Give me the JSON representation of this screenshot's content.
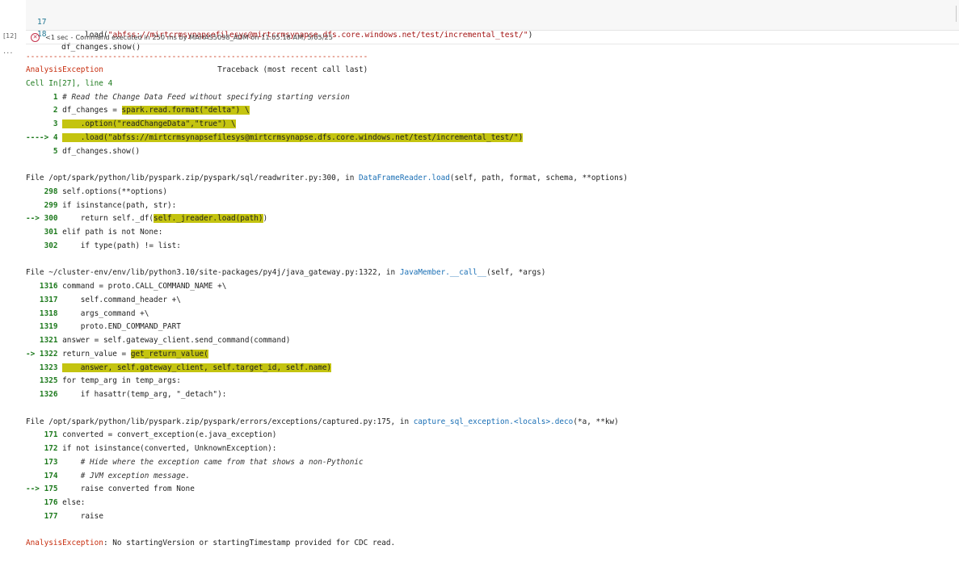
{
  "cell_editor": {
    "lines": [
      {
        "number": "17",
        "prefix": "    .load(",
        "string": "\"abfss://mirtcrmsynapsefilesys@mirtcrmsynapse.dfs.core.windows.net/test/incremental_test/\"",
        "suffix": ")"
      },
      {
        "number": "18",
        "prefix": "df_changes.show()",
        "string": "",
        "suffix": ""
      }
    ]
  },
  "status": {
    "cell_counter": "[12]",
    "duration": "<1 sec",
    "separator": "-",
    "message": "Command executed in 250 ms by MAHAS5098_ADM on 11:05:18 AM, 5/05/25",
    "output_toggle": "..."
  },
  "traceback": {
    "separator": "---------------------------------------------------------------------------",
    "header_exception": "AnalysisException",
    "header_traceback": "Traceback (most recent call last)",
    "cell_ref": "Cell In[27], line 4",
    "blocks": [
      {
        "lines": [
          {
            "marker": "      1",
            "text": " # Read the Change Data Feed without specifying starting version",
            "style": "italic"
          },
          {
            "marker": "      2",
            "text": " df_changes = ",
            "hl": "spark.read.format(\"delta\") \\",
            "after": ""
          },
          {
            "marker": "      3",
            "text": " ",
            "hl": "    .option(\"readChangeData\",\"true\") \\",
            "after": ""
          },
          {
            "marker": "----> 4",
            "text": " ",
            "hl": "    .load(\"abfss://mirtcrmsynapsefilesys@mirtcrmsynapse.dfs.core.windows.net/test/incremental_test/\")",
            "after": ""
          },
          {
            "marker": "      5",
            "text": " df_changes.show()",
            "hl": "",
            "after": ""
          }
        ]
      }
    ],
    "files": [
      {
        "prefix": "File /opt/spark/python/lib/pyspark.zip/pyspark/sql/readwriter.py:300, in ",
        "func": "DataFrameReader.load",
        "args": "(self, path, format, schema, **options)",
        "lines": [
          {
            "marker": "    298",
            "text": " self.options(**options)",
            "hl": "",
            "after": ""
          },
          {
            "marker": "    299",
            "text": " if isinstance(path, str):",
            "hl": "",
            "after": ""
          },
          {
            "marker": "--> 300",
            "text": "     return self._df(",
            "hl": "self._jreader.load(path)",
            "after": ")"
          },
          {
            "marker": "    301",
            "text": " elif path is not None:",
            "hl": "",
            "after": ""
          },
          {
            "marker": "    302",
            "text": "     if type(path) != list:",
            "hl": "",
            "after": ""
          }
        ]
      },
      {
        "prefix": "File ~/cluster-env/env/lib/python3.10/site-packages/py4j/java_gateway.py:1322, in ",
        "func": "JavaMember.__call__",
        "args": "(self, *args)",
        "lines": [
          {
            "marker": "   1316",
            "text": " command = proto.CALL_COMMAND_NAME +\\",
            "hl": "",
            "after": ""
          },
          {
            "marker": "   1317",
            "text": "     self.command_header +\\",
            "hl": "",
            "after": ""
          },
          {
            "marker": "   1318",
            "text": "     args_command +\\",
            "hl": "",
            "after": ""
          },
          {
            "marker": "   1319",
            "text": "     proto.END_COMMAND_PART",
            "hl": "",
            "after": ""
          },
          {
            "marker": "   1321",
            "text": " answer = self.gateway_client.send_command(command)",
            "hl": "",
            "after": ""
          },
          {
            "marker": "-> 1322",
            "text": " return_value = ",
            "hl": "get_return_value(",
            "after": ""
          },
          {
            "marker": "   1323",
            "text": " ",
            "hl": "    answer, self.gateway_client, self.target_id, self.name)",
            "after": ""
          },
          {
            "marker": "   1325",
            "text": " for temp_arg in temp_args:",
            "hl": "",
            "after": ""
          },
          {
            "marker": "   1326",
            "text": "     if hasattr(temp_arg, \"_detach\"):",
            "hl": "",
            "after": ""
          }
        ]
      },
      {
        "prefix": "File /opt/spark/python/lib/pyspark.zip/pyspark/errors/exceptions/captured.py:175, in ",
        "func": "capture_sql_exception.<locals>.deco",
        "args": "(*a, **kw)",
        "lines": [
          {
            "marker": "    171",
            "text": " converted = convert_exception(e.java_exception)",
            "hl": "",
            "after": ""
          },
          {
            "marker": "    172",
            "text": " if not isinstance(converted, UnknownException):",
            "hl": "",
            "after": ""
          },
          {
            "marker": "    173",
            "text": "     # Hide where the exception came from that shows a non-Pythonic",
            "style": "italic"
          },
          {
            "marker": "    174",
            "text": "     # JVM exception message.",
            "style": "italic"
          },
          {
            "marker": "--> 175",
            "text": "     raise converted from None",
            "hl": "",
            "after": ""
          },
          {
            "marker": "    176",
            "text": " else:",
            "hl": "",
            "after": ""
          },
          {
            "marker": "    177",
            "text": "     raise",
            "hl": "",
            "after": ""
          }
        ]
      }
    ],
    "final_exception": "AnalysisException",
    "final_message": ": No startingVersion or startingTimestamp provided for CDC read."
  },
  "colors": {
    "error_red": "#c72e0f",
    "link_blue": "#1a6fb5",
    "line_green": "#1e7a1e",
    "highlight": "#c4c410"
  }
}
